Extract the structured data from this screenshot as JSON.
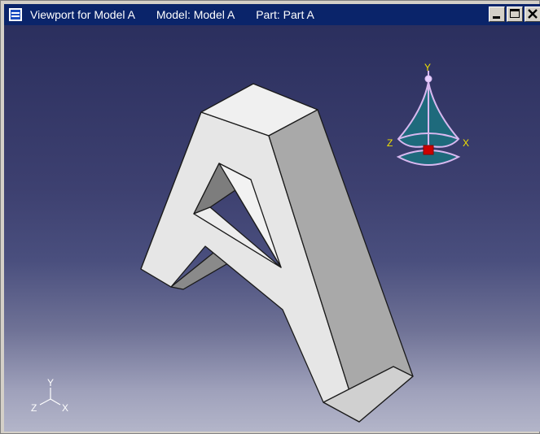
{
  "window": {
    "title_parts": {
      "viewport": "Viewport for Model A",
      "model": "Model: Model A",
      "part": "Part: Part A"
    },
    "buttons": [
      "minimize",
      "maximize",
      "close"
    ]
  },
  "compass": {
    "labels": {
      "y": "Y",
      "z": "Z",
      "x": "X"
    }
  },
  "triad": {
    "labels": {
      "y": "Y",
      "z": "Z",
      "x": "X"
    }
  },
  "colors": {
    "titlebar": "#0a246a",
    "viewport_top": "#2b2f5e",
    "viewport_bottom": "#b3b5c9",
    "compass_fill": "#1e6a7c",
    "compass_outline": "#d8b8f0",
    "compass_labels": "#f0e000",
    "compass_center": "#cc0000",
    "part_face_light": "#e8e8e8",
    "part_face_shade": "#a8a8a8"
  }
}
